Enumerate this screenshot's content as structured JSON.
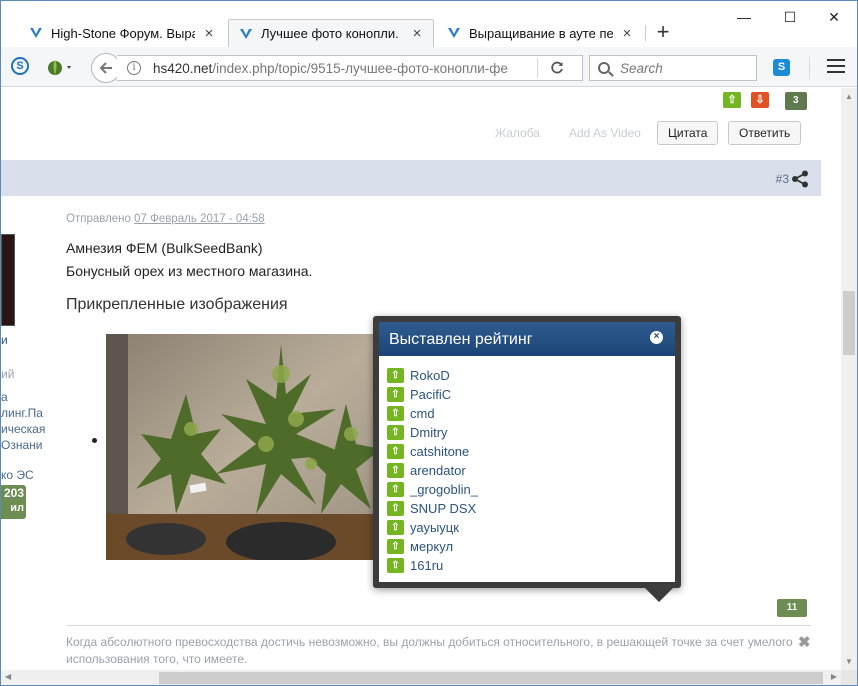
{
  "browser": {
    "tabs": [
      {
        "label": "High-Stone Форум. Выра…",
        "close": "×",
        "active": false
      },
      {
        "label": "Лучшее фото конопли. …",
        "close": "×",
        "active": true
      },
      {
        "label": "Выращивание в ауте пер…",
        "close": "×",
        "active": false
      }
    ],
    "new_tab": "+",
    "window_controls": {
      "minimize": "—",
      "maximize": "☐",
      "close": "✕"
    },
    "skype_label": "S",
    "url_host": "hs420.net",
    "url_path": "/index.php/topic/9515-лучшее-фото-конопли-фе",
    "search_placeholder": "Search"
  },
  "post": {
    "top_rating_count": "3",
    "links": {
      "report": "Жалоба",
      "add_video": "Add As Video"
    },
    "buttons": {
      "quote": "Цитата",
      "reply": "Ответить"
    },
    "post_number": "#3",
    "posted_label": "Отправлено",
    "posted_date": "07 Февраль 2017 - 04:58",
    "line1": "Амнезия ФЕМ (BulkSeedBank)",
    "line2": "Бонусный орех из местного магазина.",
    "attachments_title": "Прикрепленные изображения",
    "bottom_count": "11",
    "signature": "Когда абсолютного превосходства достичь невозможно, вы должны добиться относительного, в решающей точке за счет умелого использования того, что имеете."
  },
  "left_column": {
    "frag1": "и",
    "frag2": "ий",
    "frag3": "а",
    "frag4": "линг.Па",
    "frag5": "ическая",
    "frag6": "Ознани",
    "frag7": "ко ЭС",
    "rep_value": "203",
    "rep_label": "ил"
  },
  "popup": {
    "title": "Выставлен рейтинг",
    "users": [
      "RokoD",
      "PacifiC",
      "cmd",
      "Dmitry",
      "catshitone",
      "arendator",
      "_grogoblin_",
      "SNUP DSX",
      "уауыуцк",
      "меркул",
      "161ru"
    ]
  },
  "colors": {
    "accent": "#1c4577",
    "up": "#75b521",
    "down": "#e0521f",
    "rep": "#6e8d52"
  }
}
